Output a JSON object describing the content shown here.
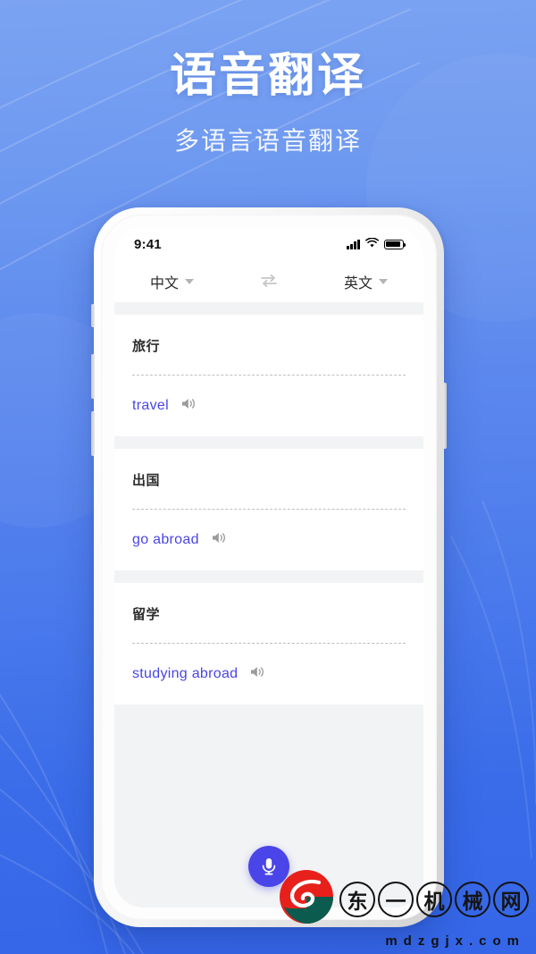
{
  "hero": {
    "title": "语音翻译",
    "subtitle": "多语言语音翻译"
  },
  "colors": {
    "bg_top": "#7ba3f2",
    "bg_bottom": "#3566e8",
    "accent": "#4a45e8",
    "screen_bg": "#f2f3f5",
    "card_bg": "#ffffff"
  },
  "phone": {
    "statusbar": {
      "time": "9:41",
      "signal_icon": "signal-bars-icon",
      "wifi_icon": "wifi-icon",
      "battery_icon": "battery-icon"
    },
    "langbar": {
      "source_language": "中文",
      "target_language": "英文",
      "swap_icon": "swap-arrows-icon",
      "caret_icon": "chevron-down-icon"
    },
    "cards": [
      {
        "source": "旅行",
        "target": "travel",
        "speaker_icon": "speaker-icon"
      },
      {
        "source": "出国",
        "target": "go abroad",
        "speaker_icon": "speaker-icon"
      },
      {
        "source": "留学",
        "target": "studying abroad",
        "speaker_icon": "speaker-icon"
      }
    ],
    "mic_button": {
      "icon": "microphone-icon",
      "label": ""
    }
  },
  "watermark": {
    "logo_icon": "dongyi-logo-icon",
    "characters": [
      "东",
      "一",
      "机",
      "械",
      "网"
    ],
    "url": "mdzgjx.com"
  }
}
